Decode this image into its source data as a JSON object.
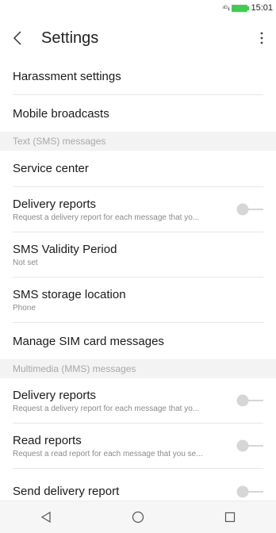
{
  "status_bar": {
    "time": "15:01",
    "signal": "⁴ᴳ ᵢₗ"
  },
  "toolbar": {
    "title": "Settings"
  },
  "items_a": [
    {
      "title": "Harassment settings"
    },
    {
      "title": "Mobile broadcasts"
    }
  ],
  "section_sms": {
    "label": "Text (SMS) messages"
  },
  "sms_items": {
    "service_center": {
      "title": "Service center"
    },
    "delivery_reports": {
      "title": "Delivery reports",
      "subtitle": "Request a delivery report for each message that yo..."
    },
    "validity": {
      "title": "SMS Validity Period",
      "subtitle": "Not set"
    },
    "storage": {
      "title": "SMS storage location",
      "subtitle": "Phone"
    },
    "manage_sim": {
      "title": "Manage SIM card messages"
    }
  },
  "section_mms": {
    "label": "Multimedia (MMS) messages"
  },
  "mms_items": {
    "delivery_reports": {
      "title": "Delivery reports",
      "subtitle": "Request a delivery report for each message that yo..."
    },
    "read_reports": {
      "title": "Read reports",
      "subtitle": "Request a read report for each message that you se..."
    },
    "send_delivery": {
      "title": "Send delivery report"
    }
  },
  "colors": {
    "toggle_off": "#d6d6d6",
    "section_bg": "#f3f3f3",
    "battery": "#3ccf4e"
  }
}
